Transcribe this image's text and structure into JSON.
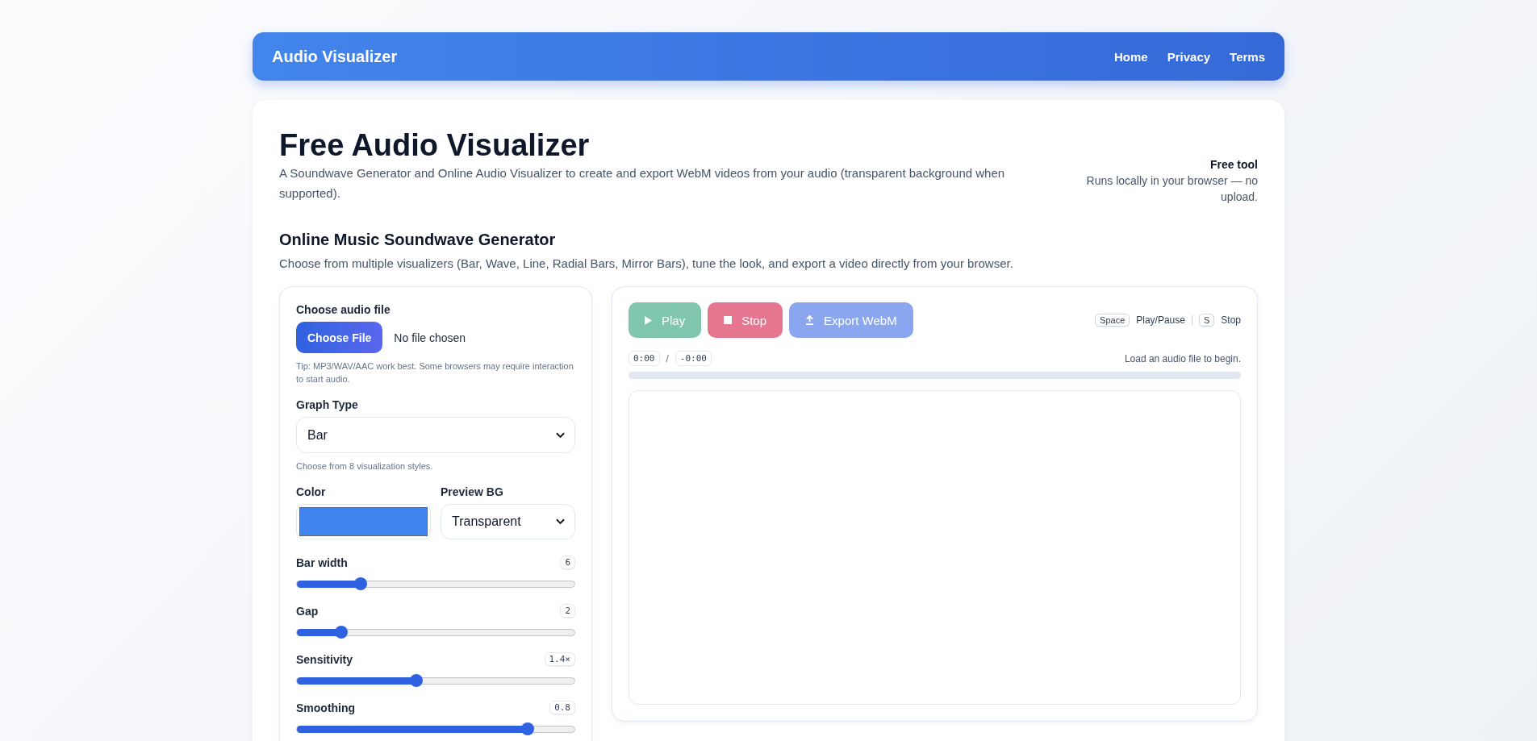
{
  "header": {
    "brand": "Audio Visualizer",
    "nav": [
      "Home",
      "Privacy",
      "Terms"
    ]
  },
  "intro": {
    "title": "Free Audio Visualizer",
    "subtitle": "A Soundwave Generator and Online Audio Visualizer to create and export WebM videos from your audio (transparent background when supported).",
    "badge_title": "Free tool",
    "badge_text": "Runs locally in your browser — no upload.",
    "heading": "Online Music Soundwave Generator",
    "description": "Choose from multiple visualizers (Bar, Wave, Line, Radial Bars, Mirror Bars), tune the look, and export a video directly from your browser."
  },
  "controls": {
    "file_label": "Choose audio file",
    "file_button": "Choose File",
    "file_status": "No file chosen",
    "tip": "Tip: MP3/WAV/AAC work best. Some browsers may require interaction to start audio.",
    "graph_label": "Graph Type",
    "graph_value": "Bar",
    "graph_help": "Choose from 8 visualization styles.",
    "color_label": "Color",
    "color": "#3f83ef",
    "bg_label": "Preview BG",
    "bg_value": "Transparent",
    "sliders": [
      {
        "label": "Bar width",
        "value": "6",
        "level": 0.23
      },
      {
        "label": "Gap",
        "value": "2",
        "level": 0.16
      },
      {
        "label": "Sensitivity",
        "value": "1.4×",
        "level": 0.43
      },
      {
        "label": "Smoothing",
        "value": "0.8",
        "level": 0.83
      }
    ]
  },
  "player": {
    "buttons": [
      {
        "kind": "play",
        "label": "Play",
        "disabled": true
      },
      {
        "kind": "stop",
        "label": "Stop",
        "disabled": true
      },
      {
        "kind": "export",
        "label": "Export WebM",
        "disabled": true
      }
    ],
    "shortcuts": [
      {
        "key": "Space",
        "action": "Play/Pause"
      },
      {
        "key": "S",
        "action": "Stop"
      }
    ],
    "time_current": "0:00",
    "time_separator": "/",
    "time_remaining": "-0:00",
    "status": "Load an audio file to begin.",
    "progress": {
      "level": 0
    }
  }
}
